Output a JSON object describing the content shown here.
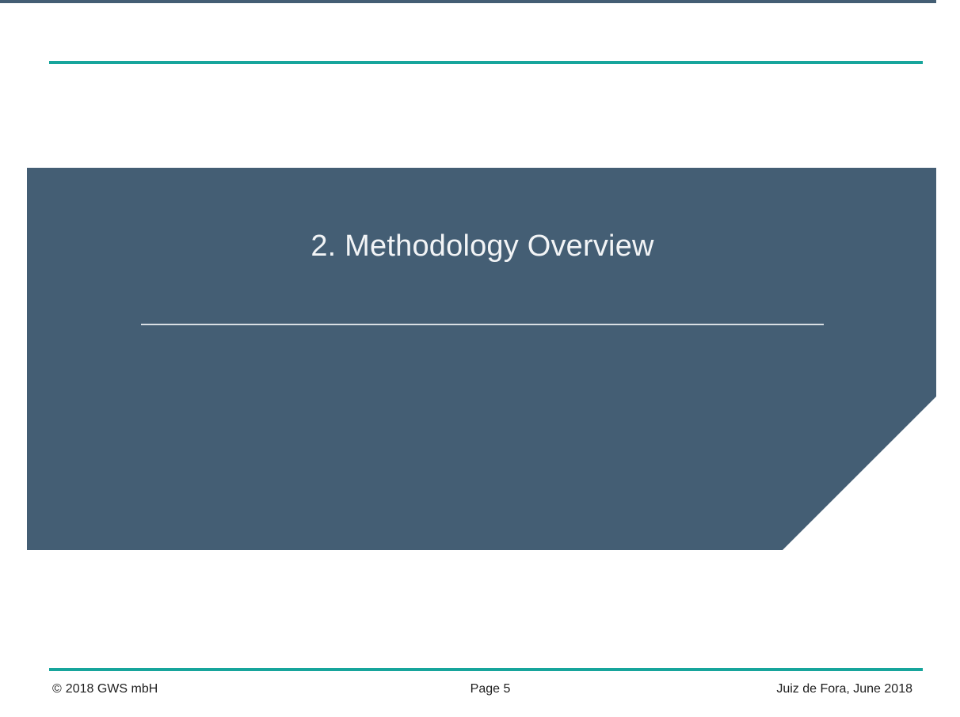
{
  "slide": {
    "section_title": "2. Methodology Overview"
  },
  "footer": {
    "copyright_symbol": "©",
    "copyright_text": "2018 GWS mbH",
    "page_label": "Page 5",
    "location_date": "Juiz de Fora, June 2018"
  },
  "colors": {
    "banner": "#445e74",
    "accent_rule": "#17a59c",
    "title_text": "#f2f4f6"
  }
}
